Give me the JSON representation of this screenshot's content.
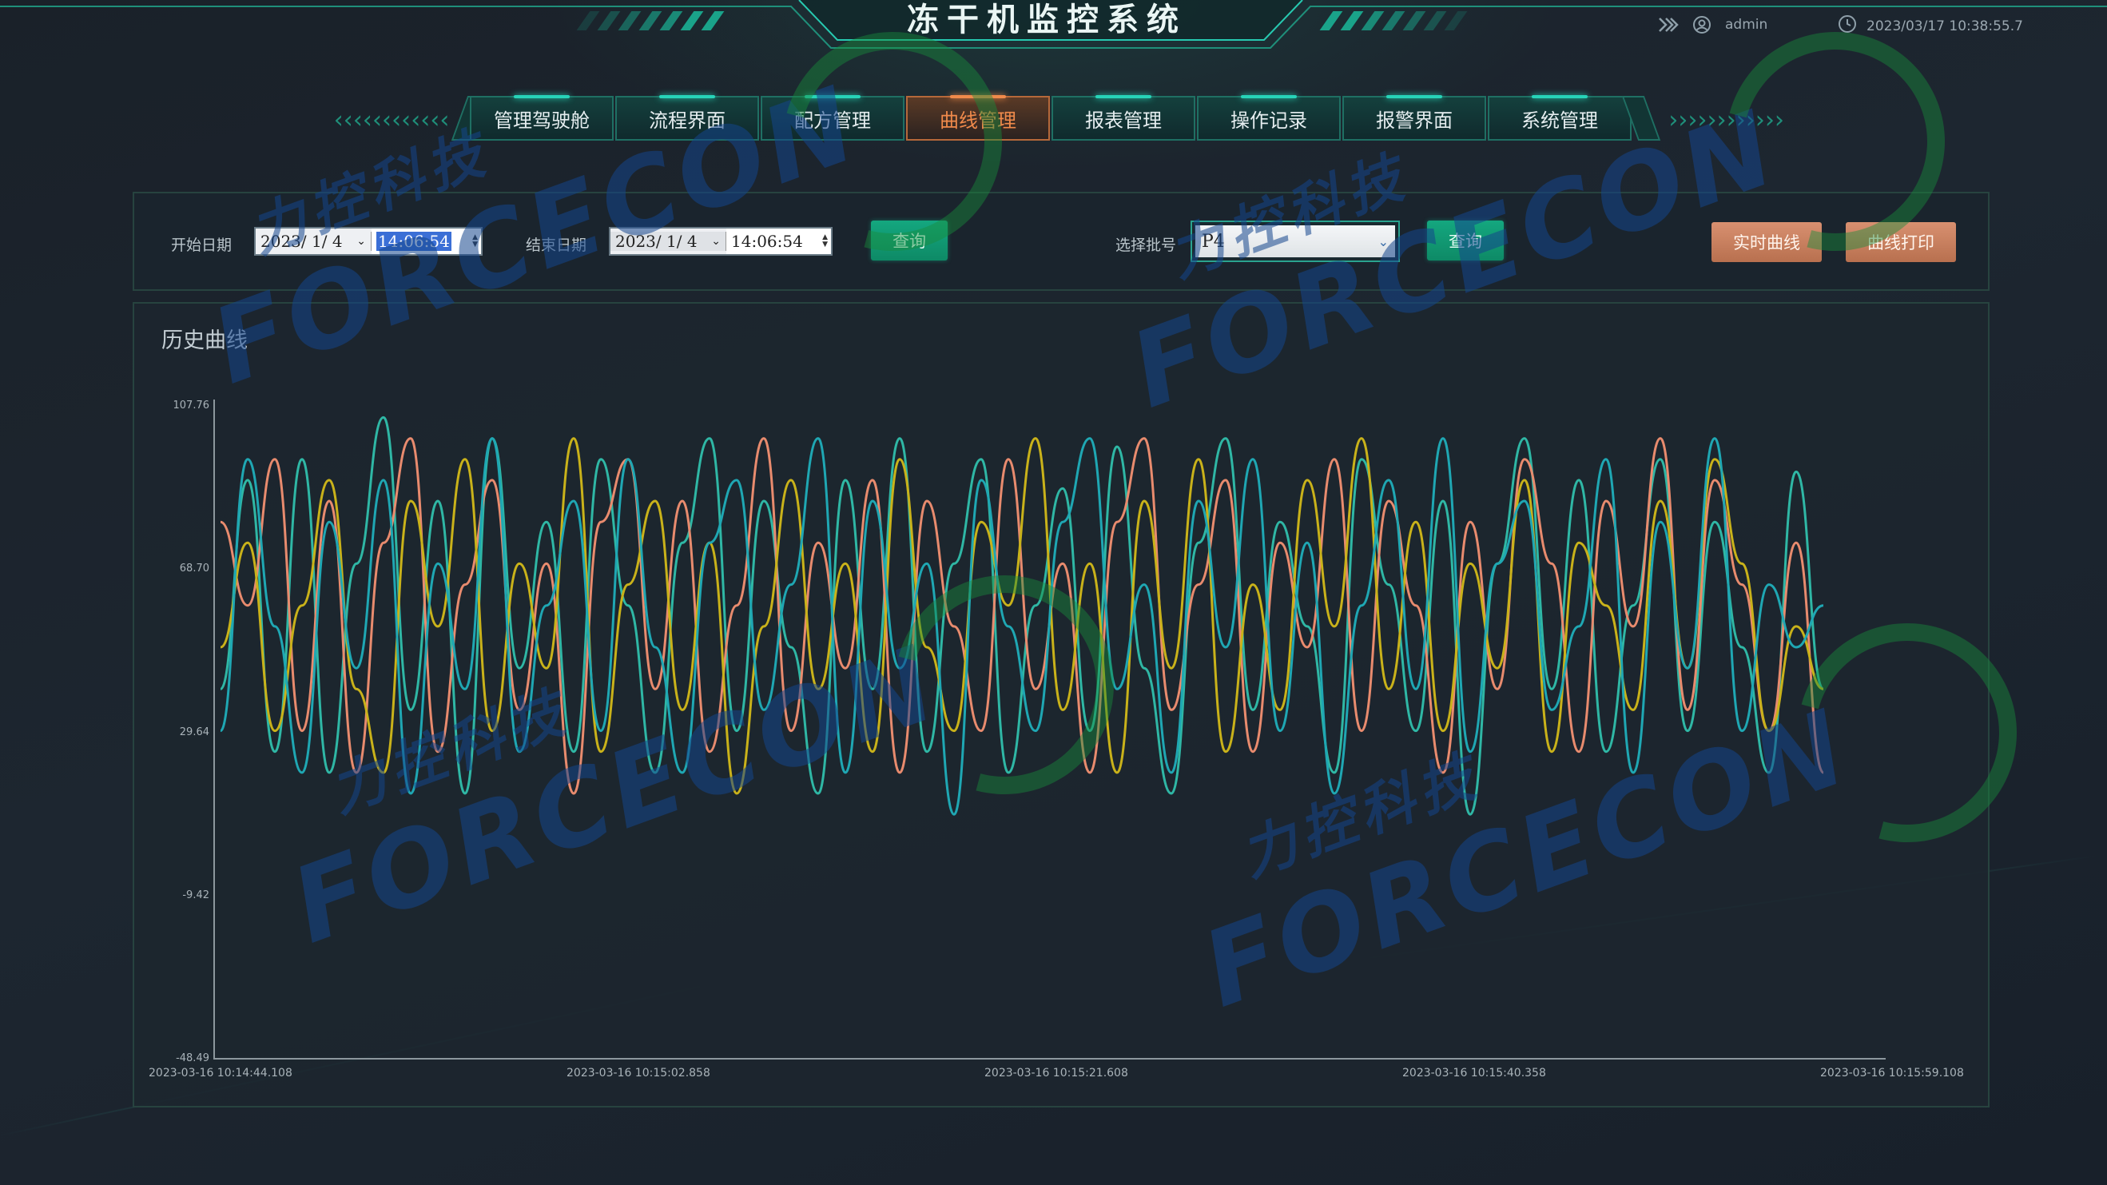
{
  "app": {
    "title": "冻干机监控系统",
    "user": "admin",
    "datetime": "2023/03/17 10:38:55.7"
  },
  "nav": {
    "items": [
      "管理驾驶舱",
      "流程界面",
      "配方管理",
      "曲线管理",
      "报表管理",
      "操作记录",
      "报警界面",
      "系统管理"
    ],
    "active_index": 3
  },
  "filters": {
    "start_label": "开始日期",
    "start_date": "2023/ 1/ 4",
    "start_time": "14:06:54",
    "end_label": "结束日期",
    "end_date": "2023/ 1/ 4",
    "end_time": "14:06:54",
    "query1_label": "查询",
    "batch_label": "选择批号",
    "batch_value": "P4",
    "query2_label": "查询",
    "realtime_label": "实时曲线",
    "print_label": "曲线打印"
  },
  "watermark": {
    "cn": "力控科技",
    "en": "FORCECON"
  },
  "colors": {
    "accent": "#1aa38a",
    "active": "#f08a4b",
    "series": [
      "#2fb7a5",
      "#e88b6e",
      "#c9b21a",
      "#1fa7b3"
    ]
  },
  "chart_data": {
    "type": "line",
    "title": "历史曲线",
    "yticks": [
      "107.76",
      "68.70",
      "29.64",
      "-9.42",
      "-48.49"
    ],
    "ylim": [
      -48.49,
      107.76
    ],
    "xticks": [
      "2023-03-16 10:14:44.108",
      "2023-03-16 10:15:02.858",
      "2023-03-16 10:15:21.608",
      "2023-03-16 10:15:40.358",
      "2023-03-16 10:15:59.108"
    ],
    "grid": false,
    "legend": "none",
    "series": [
      {
        "values": [
          40,
          90,
          25,
          95,
          20,
          70,
          105,
          35,
          85,
          15,
          100,
          45,
          80,
          25,
          95,
          60,
          20,
          75,
          100,
          30,
          85,
          50,
          15,
          90,
          40,
          100,
          25,
          70,
          95,
          20,
          60,
          88,
          30,
          98,
          45,
          15,
          75,
          100,
          35,
          80,
          55,
          20,
          95,
          65,
          30,
          85,
          10,
          70,
          100,
          40,
          90,
          25,
          60,
          95,
          30,
          80,
          50,
          20,
          92,
          40
        ]
      },
      {
        "values": [
          80,
          60,
          95,
          30,
          85,
          20,
          75,
          100,
          25,
          65,
          90,
          35,
          70,
          15,
          80,
          95,
          40,
          85,
          25,
          60,
          100,
          30,
          75,
          45,
          90,
          20,
          85,
          55,
          30,
          95,
          40,
          70,
          20,
          80,
          100,
          35,
          65,
          90,
          25,
          75,
          50,
          95,
          30,
          85,
          60,
          20,
          80,
          40,
          95,
          70,
          25,
          85,
          55,
          100,
          35,
          90,
          65,
          30,
          75,
          20
        ]
      },
      {
        "values": [
          50,
          75,
          30,
          60,
          90,
          40,
          20,
          85,
          55,
          95,
          30,
          70,
          45,
          100,
          25,
          65,
          85,
          35,
          75,
          15,
          55,
          90,
          40,
          70,
          25,
          95,
          50,
          30,
          80,
          60,
          100,
          35,
          70,
          20,
          85,
          45,
          95,
          25,
          65,
          35,
          90,
          55,
          100,
          40,
          80,
          30,
          70,
          45,
          90,
          25,
          75,
          60,
          35,
          85,
          45,
          95,
          70,
          30,
          55,
          40
        ]
      },
      {
        "values": [
          30,
          95,
          55,
          20,
          80,
          45,
          90,
          15,
          70,
          40,
          100,
          25,
          60,
          85,
          30,
          95,
          50,
          20,
          75,
          90,
          35,
          65,
          100,
          20,
          85,
          45,
          70,
          10,
          90,
          55,
          30,
          80,
          100,
          40,
          65,
          20,
          85,
          50,
          95,
          30,
          75,
          15,
          60,
          90,
          40,
          100,
          25,
          70,
          85,
          35,
          55,
          95,
          20,
          80,
          45,
          100,
          30,
          65,
          50,
          60
        ]
      }
    ]
  }
}
